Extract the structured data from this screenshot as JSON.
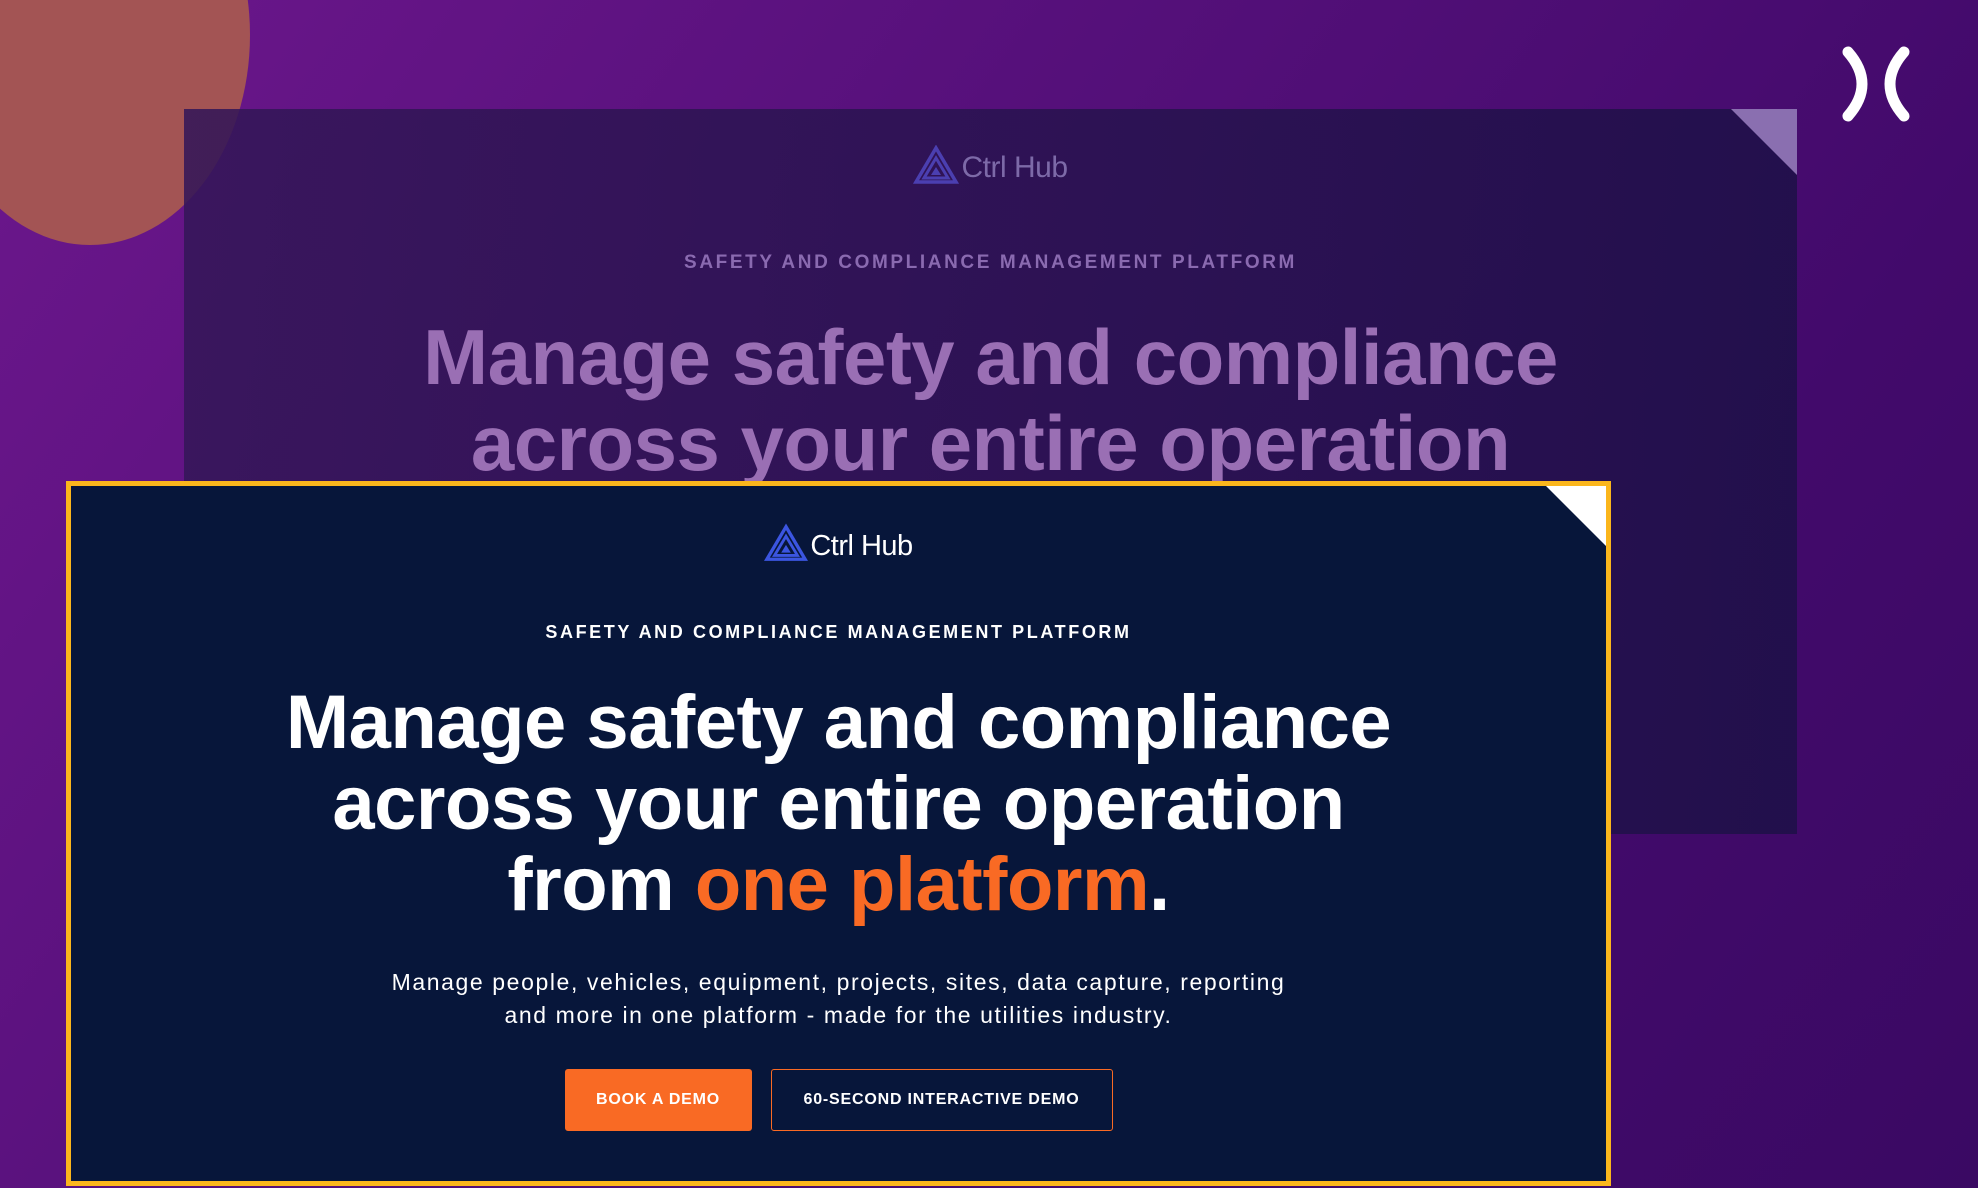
{
  "colors": {
    "accent": "#f96a24",
    "highlight_border": "#fbb61c",
    "card_background": "#07163a",
    "logo_mark": "#3b55e0"
  },
  "icons": {
    "close": "close-icon",
    "logo": "ctrl-hub-triangle-logo-icon"
  },
  "background_card": {
    "logo_text": "Ctrl Hub",
    "eyebrow": "SAFETY AND COMPLIANCE MANAGEMENT PLATFORM",
    "headline_line1": "Manage safety and compliance",
    "headline_line2": "across your entire operation"
  },
  "card": {
    "logo_text": "Ctrl Hub",
    "eyebrow": "SAFETY AND COMPLIANCE MANAGEMENT PLATFORM",
    "headline_line1": "Manage safety and compliance",
    "headline_line2": "across your entire operation",
    "headline_line3_prefix": "from ",
    "headline_line3_accent": "one platform",
    "headline_line3_suffix": ".",
    "sub_line1": "Manage people, vehicles, equipment, projects, sites, data capture, reporting",
    "sub_line2": "and more in one platform - made for the utilities industry.",
    "primary_button": "BOOK A DEMO",
    "secondary_button": "60-SECOND INTERACTIVE DEMO"
  }
}
